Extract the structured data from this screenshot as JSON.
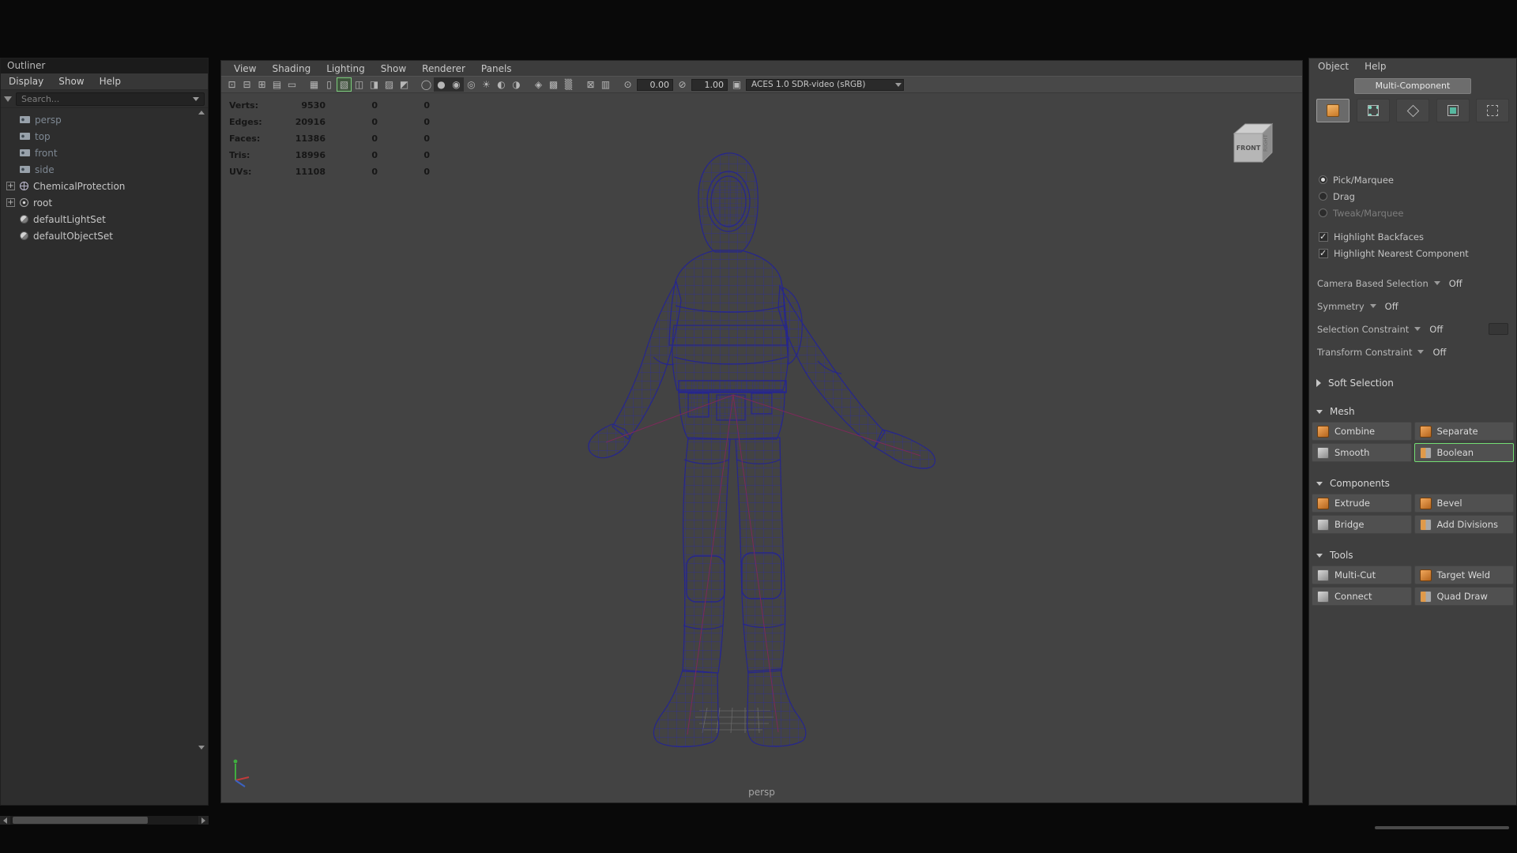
{
  "outliner": {
    "title": "Outliner",
    "menus": [
      "Display",
      "Show",
      "Help"
    ],
    "search_placeholder": "Search...",
    "items": [
      {
        "label": "persp"
      },
      {
        "label": "top"
      },
      {
        "label": "front"
      },
      {
        "label": "side"
      },
      {
        "label": "ChemicalProtection"
      },
      {
        "label": "root"
      },
      {
        "label": "defaultLightSet"
      },
      {
        "label": "defaultObjectSet"
      }
    ]
  },
  "viewport": {
    "menus": [
      "View",
      "Shading",
      "Lighting",
      "Show",
      "Renderer",
      "Panels"
    ],
    "toolbar": {
      "exposure": "0.00",
      "gamma": "1.00",
      "colorspace": "ACES 1.0 SDR-video (sRGB)"
    },
    "hud": {
      "rows": [
        {
          "label": "Verts:",
          "total": "9530",
          "c2": "0",
          "c3": "0"
        },
        {
          "label": "Edges:",
          "total": "20916",
          "c2": "0",
          "c3": "0"
        },
        {
          "label": "Faces:",
          "total": "11386",
          "c2": "0",
          "c3": "0"
        },
        {
          "label": "Tris:",
          "total": "18996",
          "c2": "0",
          "c3": "0"
        },
        {
          "label": "UVs:",
          "total": "11108",
          "c2": "0",
          "c3": "0"
        }
      ]
    },
    "view_cube": {
      "front": "FRONT",
      "right": "RIGHT"
    },
    "camera_label": "persp"
  },
  "toolkit": {
    "menus": [
      "Object",
      "Help"
    ],
    "mode_button": "Multi-Component",
    "options": [
      {
        "label": "Pick/Marquee"
      },
      {
        "label": "Drag"
      },
      {
        "label": "Tweak/Marquee"
      },
      {
        "label": "Highlight Backfaces"
      },
      {
        "label": "Highlight Nearest Component"
      }
    ],
    "dropdowns": [
      {
        "label": "Camera Based Selection",
        "value": "Off"
      },
      {
        "label": "Symmetry",
        "value": "Off"
      },
      {
        "label": "Selection Constraint",
        "value": "Off"
      },
      {
        "label": "Transform Constraint",
        "value": "Off"
      }
    ],
    "soft_selection": "Soft Selection",
    "sections": [
      {
        "title": "Mesh",
        "buttons": [
          {
            "label": "Combine"
          },
          {
            "label": "Separate"
          },
          {
            "label": "Smooth"
          },
          {
            "label": "Boolean"
          }
        ]
      },
      {
        "title": "Components",
        "buttons": [
          {
            "label": "Extrude"
          },
          {
            "label": "Bevel"
          },
          {
            "label": "Bridge"
          },
          {
            "label": "Add Divisions"
          }
        ]
      },
      {
        "title": "Tools",
        "buttons": [
          {
            "label": "Multi-Cut"
          },
          {
            "label": "Target Weld"
          },
          {
            "label": "Connect"
          },
          {
            "label": "Quad Draw"
          }
        ]
      }
    ]
  }
}
